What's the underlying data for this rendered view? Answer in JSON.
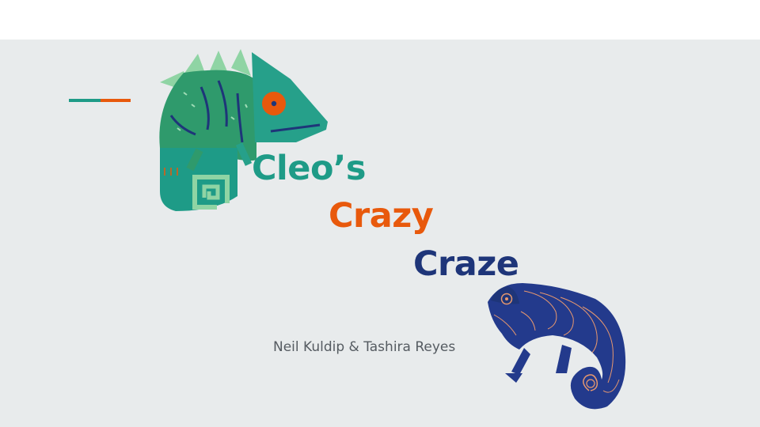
{
  "slide": {
    "title_line1": "Cleo’s",
    "title_line2": "Crazy",
    "title_line3": "Craze",
    "authors": "Neil Kuldip & Tashira Reyes"
  },
  "colors": {
    "background": "#e8ebec",
    "teal": "#1e9b87",
    "orange": "#e8590c",
    "navy": "#1e3579",
    "green_dark": "#2f9a6c",
    "green_light": "#8fd4a4",
    "text_gray": "#555b61"
  },
  "icons": {
    "top_chameleon": "green-chameleon-illustration",
    "bottom_chameleon": "blue-chameleon-illustration"
  }
}
